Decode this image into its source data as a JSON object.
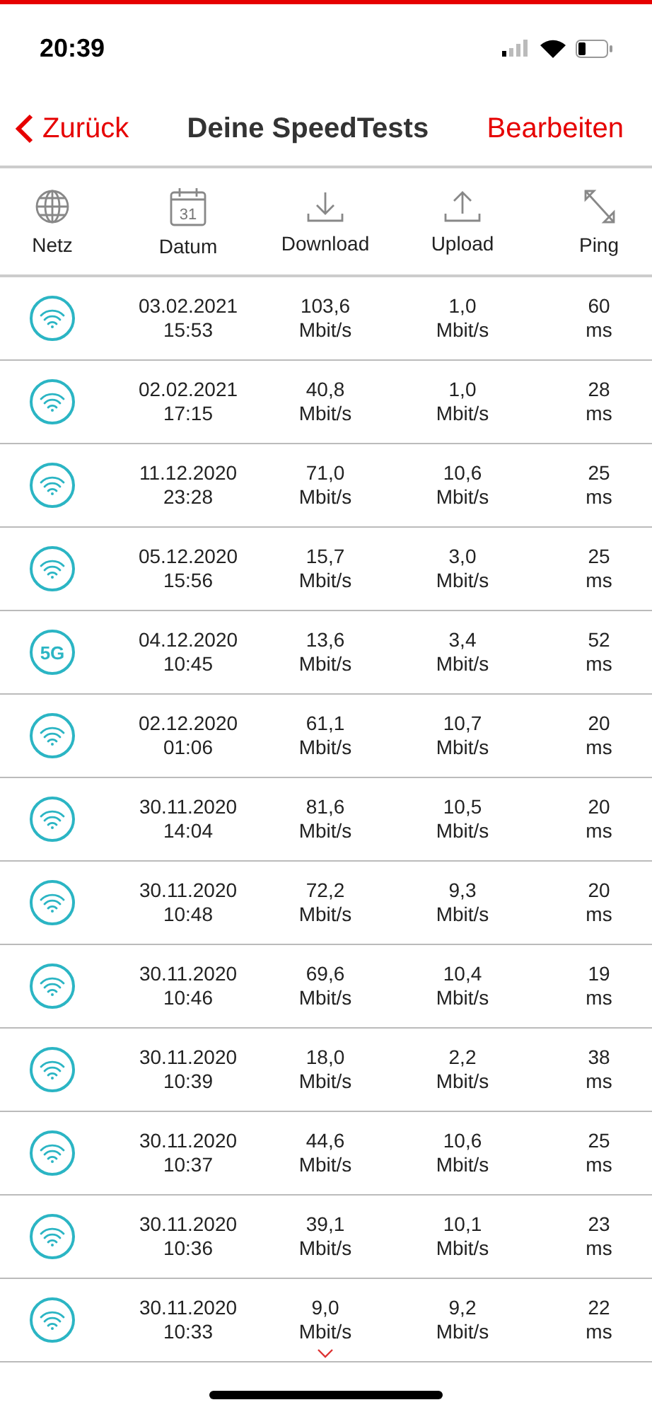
{
  "status_bar": {
    "time": "20:39"
  },
  "nav": {
    "back": "Zurück",
    "title": "Deine SpeedTests",
    "action": "Bearbeiten"
  },
  "columns": [
    {
      "label": "Netz",
      "kind": "network"
    },
    {
      "label": "Datum",
      "kind": "date",
      "icon_text": "31"
    },
    {
      "label": "Download",
      "kind": "download"
    },
    {
      "label": "Upload",
      "kind": "upload"
    },
    {
      "label": "Ping",
      "kind": "ping"
    }
  ],
  "rows": [
    {
      "network": {
        "kind": "wifi"
      },
      "date": "03.02.2021",
      "time": "15:53",
      "download": "103,6",
      "download_unit": "Mbit/s",
      "upload": "1,0",
      "upload_unit": "Mbit/s",
      "ping": "60",
      "ping_unit": "ms"
    },
    {
      "network": {
        "kind": "wifi"
      },
      "date": "02.02.2021",
      "time": "17:15",
      "download": "40,8",
      "download_unit": "Mbit/s",
      "upload": "1,0",
      "upload_unit": "Mbit/s",
      "ping": "28",
      "ping_unit": "ms"
    },
    {
      "network": {
        "kind": "wifi"
      },
      "date": "11.12.2020",
      "time": "23:28",
      "download": "71,0",
      "download_unit": "Mbit/s",
      "upload": "10,6",
      "upload_unit": "Mbit/s",
      "ping": "25",
      "ping_unit": "ms"
    },
    {
      "network": {
        "kind": "wifi"
      },
      "date": "05.12.2020",
      "time": "15:56",
      "download": "15,7",
      "download_unit": "Mbit/s",
      "upload": "3,0",
      "upload_unit": "Mbit/s",
      "ping": "25",
      "ping_unit": "ms"
    },
    {
      "network": {
        "kind": "cellular",
        "label": "5G"
      },
      "date": "04.12.2020",
      "time": "10:45",
      "download": "13,6",
      "download_unit": "Mbit/s",
      "upload": "3,4",
      "upload_unit": "Mbit/s",
      "ping": "52",
      "ping_unit": "ms"
    },
    {
      "network": {
        "kind": "wifi"
      },
      "date": "02.12.2020",
      "time": "01:06",
      "download": "61,1",
      "download_unit": "Mbit/s",
      "upload": "10,7",
      "upload_unit": "Mbit/s",
      "ping": "20",
      "ping_unit": "ms"
    },
    {
      "network": {
        "kind": "wifi"
      },
      "date": "30.11.2020",
      "time": "14:04",
      "download": "81,6",
      "download_unit": "Mbit/s",
      "upload": "10,5",
      "upload_unit": "Mbit/s",
      "ping": "20",
      "ping_unit": "ms"
    },
    {
      "network": {
        "kind": "wifi"
      },
      "date": "30.11.2020",
      "time": "10:48",
      "download": "72,2",
      "download_unit": "Mbit/s",
      "upload": "9,3",
      "upload_unit": "Mbit/s",
      "ping": "20",
      "ping_unit": "ms"
    },
    {
      "network": {
        "kind": "wifi"
      },
      "date": "30.11.2020",
      "time": "10:46",
      "download": "69,6",
      "download_unit": "Mbit/s",
      "upload": "10,4",
      "upload_unit": "Mbit/s",
      "ping": "19",
      "ping_unit": "ms"
    },
    {
      "network": {
        "kind": "wifi"
      },
      "date": "30.11.2020",
      "time": "10:39",
      "download": "18,0",
      "download_unit": "Mbit/s",
      "upload": "2,2",
      "upload_unit": "Mbit/s",
      "ping": "38",
      "ping_unit": "ms"
    },
    {
      "network": {
        "kind": "wifi"
      },
      "date": "30.11.2020",
      "time": "10:37",
      "download": "44,6",
      "download_unit": "Mbit/s",
      "upload": "10,6",
      "upload_unit": "Mbit/s",
      "ping": "25",
      "ping_unit": "ms"
    },
    {
      "network": {
        "kind": "wifi"
      },
      "date": "30.11.2020",
      "time": "10:36",
      "download": "39,1",
      "download_unit": "Mbit/s",
      "upload": "10,1",
      "upload_unit": "Mbit/s",
      "ping": "23",
      "ping_unit": "ms"
    },
    {
      "network": {
        "kind": "wifi"
      },
      "date": "30.11.2020",
      "time": "10:33",
      "download": "9,0",
      "download_unit": "Mbit/s",
      "upload": "9,2",
      "upload_unit": "Mbit/s",
      "ping": "22",
      "ping_unit": "ms"
    }
  ]
}
